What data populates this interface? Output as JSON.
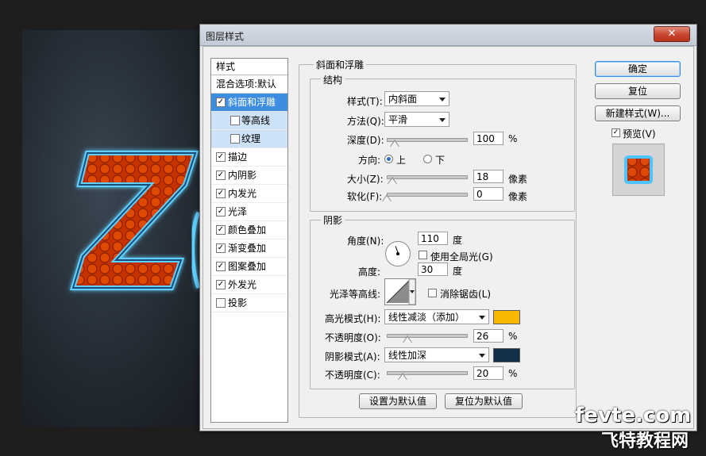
{
  "dialog": {
    "title": "图层样式",
    "close_symbol": "✕"
  },
  "styles_panel": {
    "header": "样式",
    "blend_options": "混合选项:默认",
    "items": [
      {
        "label": "斜面和浮雕",
        "checked": true,
        "active": true,
        "sub": false
      },
      {
        "label": "等高线",
        "checked": false,
        "active": false,
        "sub": true
      },
      {
        "label": "纹理",
        "checked": false,
        "active": false,
        "sub": true
      },
      {
        "label": "描边",
        "checked": true,
        "active": false,
        "sub": false
      },
      {
        "label": "内阴影",
        "checked": true,
        "active": false,
        "sub": false
      },
      {
        "label": "内发光",
        "checked": true,
        "active": false,
        "sub": false
      },
      {
        "label": "光泽",
        "checked": true,
        "active": false,
        "sub": false
      },
      {
        "label": "颜色叠加",
        "checked": true,
        "active": false,
        "sub": false
      },
      {
        "label": "渐变叠加",
        "checked": true,
        "active": false,
        "sub": false
      },
      {
        "label": "图案叠加",
        "checked": true,
        "active": false,
        "sub": false
      },
      {
        "label": "外发光",
        "checked": true,
        "active": false,
        "sub": false
      },
      {
        "label": "投影",
        "checked": false,
        "active": false,
        "sub": false
      }
    ]
  },
  "bevel": {
    "group_title": "斜面和浮雕",
    "structure": {
      "title": "结构",
      "style_label": "样式(T):",
      "style_value": "内斜面",
      "technique_label": "方法(Q):",
      "technique_value": "平滑",
      "depth_label": "深度(D):",
      "depth_value": "100",
      "depth_unit": "%",
      "depth_fraction": 0.1,
      "direction_label": "方向:",
      "direction_up": "上",
      "direction_down": "下",
      "size_label": "大小(Z):",
      "size_value": "18",
      "size_unit": "像素",
      "size_fraction": 0.07,
      "soften_label": "软化(F):",
      "soften_value": "0",
      "soften_unit": "像素",
      "soften_fraction": 0.0
    },
    "shading": {
      "title": "阴影",
      "angle_label": "角度(N):",
      "angle_value": "110",
      "angle_unit": "度",
      "global_light_label": "使用全局光(G)",
      "altitude_label": "高度:",
      "altitude_value": "30",
      "altitude_unit": "度",
      "gloss_contour_label": "光泽等高线:",
      "antialias_label": "消除锯齿(L)",
      "highlight_mode_label": "高光模式(H):",
      "highlight_mode_value": "线性减淡（添加）",
      "highlight_color": "#f8b800",
      "highlight_opacity_label": "不透明度(O):",
      "highlight_opacity_value": "26",
      "highlight_opacity_unit": "%",
      "highlight_opacity_fraction": 0.26,
      "shadow_mode_label": "阴影模式(A):",
      "shadow_mode_value": "线性加深",
      "shadow_color": "#12304a",
      "shadow_opacity_label": "不透明度(C):",
      "shadow_opacity_value": "20",
      "shadow_opacity_unit": "%",
      "shadow_opacity_fraction": 0.2
    },
    "make_default": "设置为默认值",
    "reset_default": "复位为默认值"
  },
  "side_buttons": {
    "ok": "确定",
    "reset": "复位",
    "new_style": "新建样式(W)...",
    "preview_label": "预览(V)"
  },
  "watermark": {
    "line1": "fevte.com",
    "line2": "飞特教程网"
  },
  "colors": {
    "accent": "#3d8ee0",
    "glow": "#4fc3ff",
    "letter_fill": "#d63a00"
  }
}
